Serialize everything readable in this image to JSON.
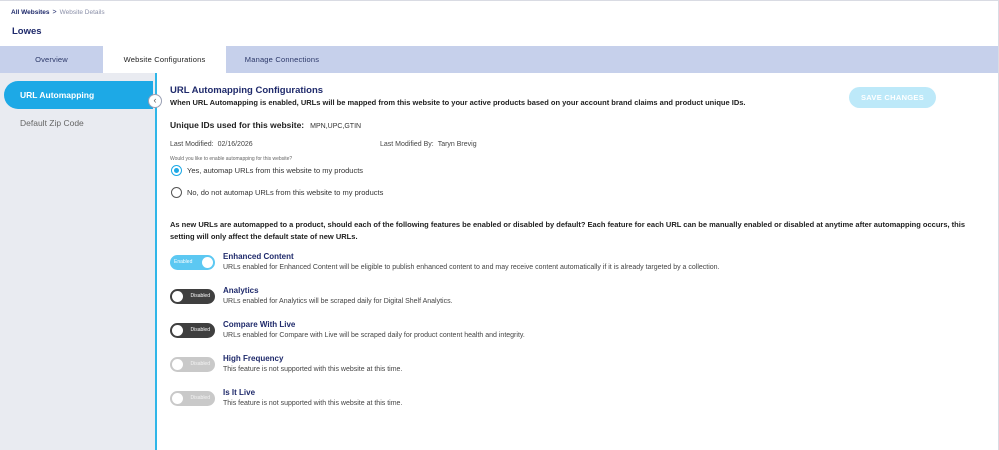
{
  "breadcrumb": {
    "root": "All Websites",
    "separator": ">",
    "current": "Website Details"
  },
  "site": {
    "name": "Lowes"
  },
  "tabs": [
    {
      "label": "Overview",
      "active": false
    },
    {
      "label": "Website Configurations",
      "active": true
    },
    {
      "label": "Manage Connections",
      "active": false
    }
  ],
  "sidebar": {
    "items": [
      {
        "label": "URL Automapping",
        "active": true
      },
      {
        "label": "Default Zip Code",
        "active": false
      }
    ],
    "collapse_glyph": "‹"
  },
  "section": {
    "title": "URL Automapping Configurations",
    "description": "When URL Automapping is enabled, URLs will be mapped from this website to your active products based on your account brand claims and product unique IDs.",
    "save_label": "SAVE CHANGES"
  },
  "unique_ids": {
    "label": "Unique IDs used for this website:",
    "value": "MPN,UPC,GTIN"
  },
  "modified": {
    "date_label": "Last Modified:",
    "date_value": "02/16/2026",
    "by_label": "Last Modified By:",
    "by_value": "Taryn Brevig"
  },
  "question": "Would you like to enable automapping for this website?",
  "options": [
    {
      "label": "Yes, automap URLs from this website to my products",
      "selected": true
    },
    {
      "label": "No, do not automap URLs from this website to my products",
      "selected": false
    }
  ],
  "features_intro": "As new URLs are automapped to a product, should each of the following features be enabled or disabled by default? Each feature for each URL can be manually enabled or disabled at anytime after automapping occurs, this setting will only affect the default state of new URLs.",
  "features": [
    {
      "name": "Enhanced Content",
      "state": "Enabled",
      "supported": true,
      "description": "URLs enabled for Enhanced Content will be eligible to publish enhanced content to and may receive content automatically if it is already targeted by a collection."
    },
    {
      "name": "Analytics",
      "state": "Disabled",
      "supported": true,
      "description": "URLs enabled for Analytics will be scraped daily for Digital Shelf Analytics."
    },
    {
      "name": "Compare With Live",
      "state": "Disabled",
      "supported": true,
      "description": "URLs enabled for Compare with Live will be scraped daily for product content health and integrity."
    },
    {
      "name": "High Frequency",
      "state": "Disabled",
      "supported": false,
      "description": "This feature is not supported with this website at this time."
    },
    {
      "name": "Is It Live",
      "state": "Disabled",
      "supported": false,
      "description": "This feature is not supported with this website at this time."
    }
  ],
  "colors": {
    "accent": "#1da9e6",
    "navy": "#1f2a6b",
    "tabbar": "#c6d0eb",
    "sidebar": "#e9ebf1",
    "toggle_on": "#5cc8f2",
    "toggle_off": "#3f3f3f",
    "toggle_disabled": "#c9c9c9"
  }
}
